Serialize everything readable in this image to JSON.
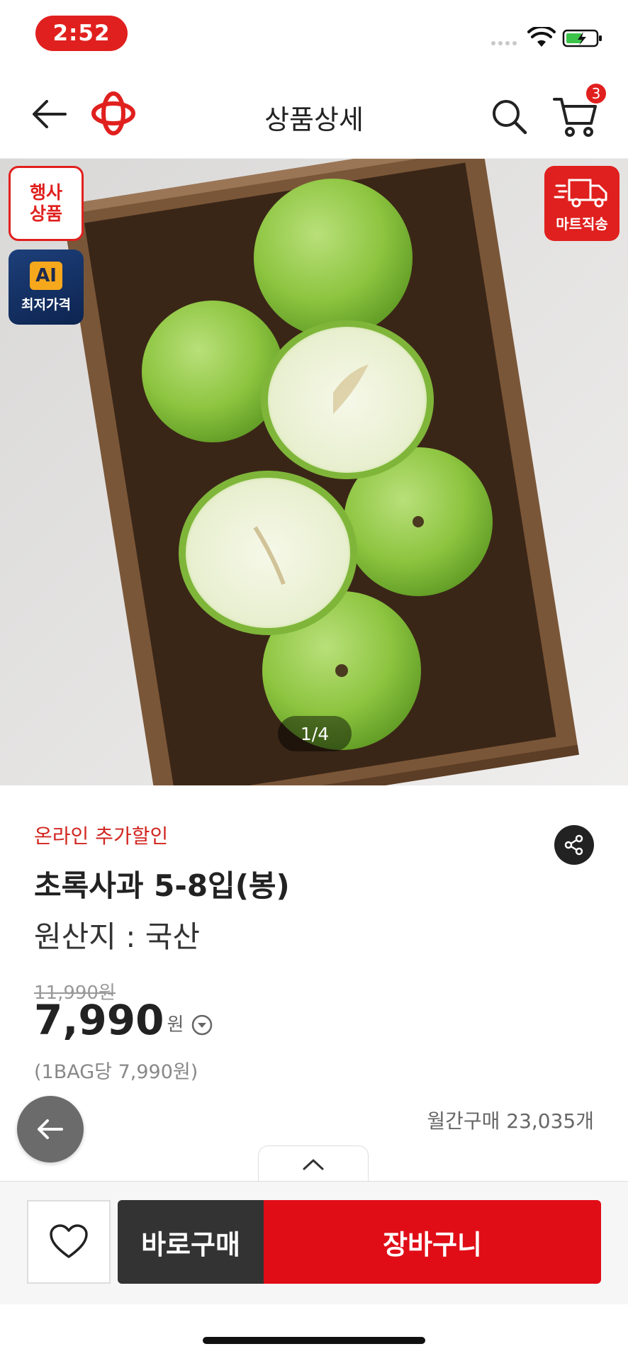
{
  "status_bar": {
    "time": "2:52"
  },
  "nav": {
    "title": "상품상세",
    "cart_count": "3"
  },
  "hero": {
    "badge_event_line1": "행사",
    "badge_event_line2": "상품",
    "badge_ai_mark": "AI",
    "badge_ai_text": "최저가격",
    "badge_direct_text": "마트직송",
    "page_indicator": "1/4"
  },
  "product": {
    "promo_label": "온라인 추가할인",
    "name": "초록사과 5-8입(봉)",
    "origin": "원산지 : 국산",
    "original_price": "11,990원",
    "price": "7,990",
    "currency": "원",
    "unit_price": "(1BAG당 7,990원)",
    "monthly_sales": "월간구매 23,035개"
  },
  "bottom_bar": {
    "buy_now_label": "바로구매",
    "add_to_cart_label": "장바구니"
  },
  "colors": {
    "brand_red": "#e0201e",
    "cart_button": "#e00d17",
    "buy_now_button": "#333333"
  }
}
